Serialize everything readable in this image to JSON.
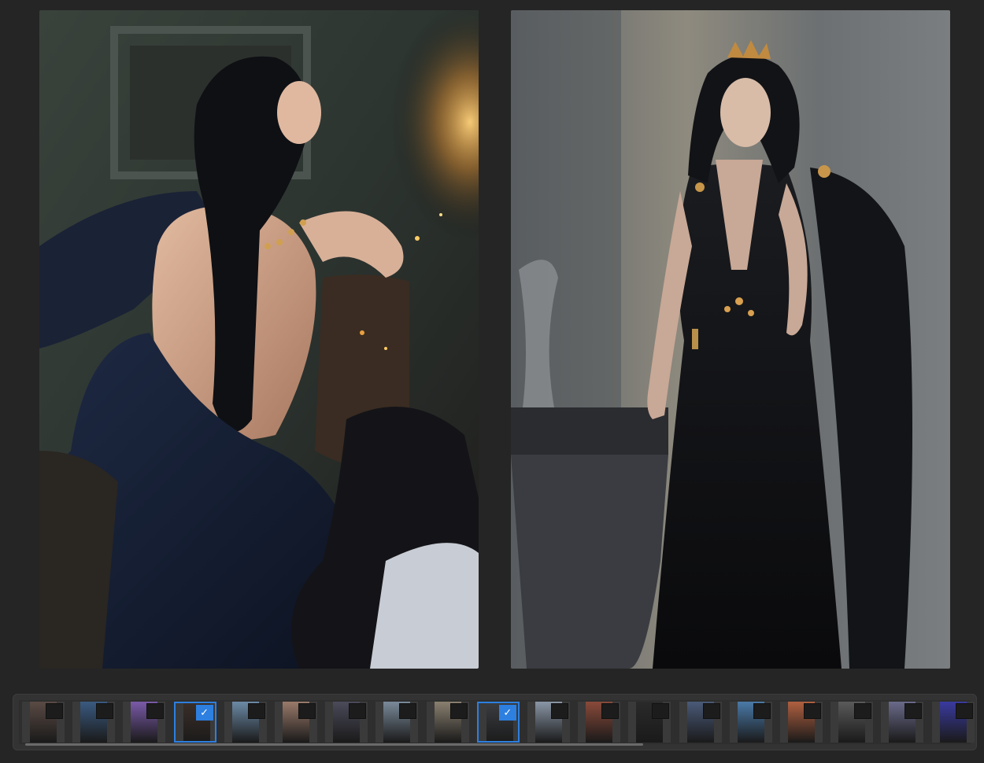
{
  "viewer": {
    "images": [
      {
        "name": "left-painting",
        "description_icon": "artwork-woman-back"
      },
      {
        "name": "right-painting",
        "description_icon": "artwork-woman-black-gown"
      }
    ]
  },
  "filmstrip": {
    "thumbnails": [
      {
        "selected": false,
        "color": "#5a4a44",
        "check": ""
      },
      {
        "selected": false,
        "color": "#3a5a80",
        "check": ""
      },
      {
        "selected": false,
        "color": "#7a5aa8",
        "check": ""
      },
      {
        "selected": true,
        "color": "#3a2e28",
        "check": "✓"
      },
      {
        "selected": false,
        "color": "#6c8aa6",
        "check": ""
      },
      {
        "selected": false,
        "color": "#9a7a6a",
        "check": ""
      },
      {
        "selected": false,
        "color": "#4a4a5a",
        "check": ""
      },
      {
        "selected": false,
        "color": "#7a8a9a",
        "check": ""
      },
      {
        "selected": false,
        "color": "#8a8070",
        "check": ""
      },
      {
        "selected": true,
        "color": "#3a3c40",
        "check": "✓"
      },
      {
        "selected": false,
        "color": "#8a96a6",
        "check": ""
      },
      {
        "selected": false,
        "color": "#8a4a3a",
        "check": ""
      },
      {
        "selected": false,
        "color": "#2a2a2a",
        "check": ""
      },
      {
        "selected": false,
        "color": "#4a5a78",
        "check": ""
      },
      {
        "selected": false,
        "color": "#4a7aa8",
        "check": ""
      },
      {
        "selected": false,
        "color": "#b06040",
        "check": ""
      },
      {
        "selected": false,
        "color": "#5a5a5a",
        "check": ""
      },
      {
        "selected": false,
        "color": "#6a6a8a",
        "check": ""
      },
      {
        "selected": false,
        "color": "#3a3aa0",
        "check": ""
      }
    ],
    "scroll_fraction": 0.66
  }
}
